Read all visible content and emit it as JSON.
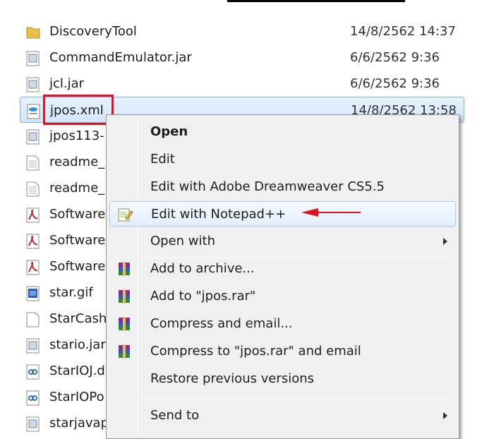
{
  "files": [
    {
      "name": "DiscoveryTool",
      "date": "14/8/2562 14:37",
      "icon": "folder-icon"
    },
    {
      "name": "CommandEmulator.jar",
      "date": "6/6/2562 9:36",
      "icon": "jar-file-icon"
    },
    {
      "name": "jcl.jar",
      "date": "6/6/2562 9:36",
      "icon": "jar-file-icon"
    },
    {
      "name": "jpos.xml",
      "date": "14/8/2562 13:58",
      "icon": "xml-file-icon"
    },
    {
      "name": "jpos113-",
      "date": "",
      "icon": "jar-file-icon"
    },
    {
      "name": "readme_",
      "date": "",
      "icon": "text-file-icon"
    },
    {
      "name": "readme_",
      "date": "",
      "icon": "text-file-icon"
    },
    {
      "name": "Software",
      "date": "",
      "icon": "pdf-file-icon"
    },
    {
      "name": "Software",
      "date": "",
      "icon": "pdf-file-icon"
    },
    {
      "name": "Software",
      "date": "",
      "icon": "pdf-file-icon"
    },
    {
      "name": "star.gif",
      "date": "",
      "icon": "image-file-icon"
    },
    {
      "name": "StarCash",
      "date": "",
      "icon": "blank-file-icon"
    },
    {
      "name": "stario.jar",
      "date": "",
      "icon": "jar-file-icon"
    },
    {
      "name": "StarIOJ.d",
      "date": "",
      "icon": "dll-file-icon"
    },
    {
      "name": "StarIOPo",
      "date": "",
      "icon": "dll-file-icon"
    },
    {
      "name": "starjavap",
      "date": "",
      "icon": "jar-file-icon"
    }
  ],
  "context_menu": {
    "items": [
      {
        "label": "Open",
        "bold": true
      },
      {
        "label": "Edit"
      },
      {
        "label": "Edit with Adobe Dreamweaver CS5.5"
      },
      {
        "label": "Edit with Notepad++",
        "icon": "notepad-plus-plus-icon"
      },
      {
        "label": "Open with",
        "submenu": true
      },
      {
        "label": "Add to archive...",
        "icon": "winrar-icon"
      },
      {
        "label": "Add to \"jpos.rar\"",
        "icon": "winrar-icon"
      },
      {
        "label": "Compress and email...",
        "icon": "winrar-icon"
      },
      {
        "label": "Compress to \"jpos.rar\" and email",
        "icon": "winrar-icon"
      },
      {
        "label": "Restore previous versions"
      },
      {
        "label": "Send to",
        "submenu": true
      }
    ]
  },
  "colors": {
    "annotation_red": "#e0141e",
    "selection_border": "#7eb4ea"
  }
}
